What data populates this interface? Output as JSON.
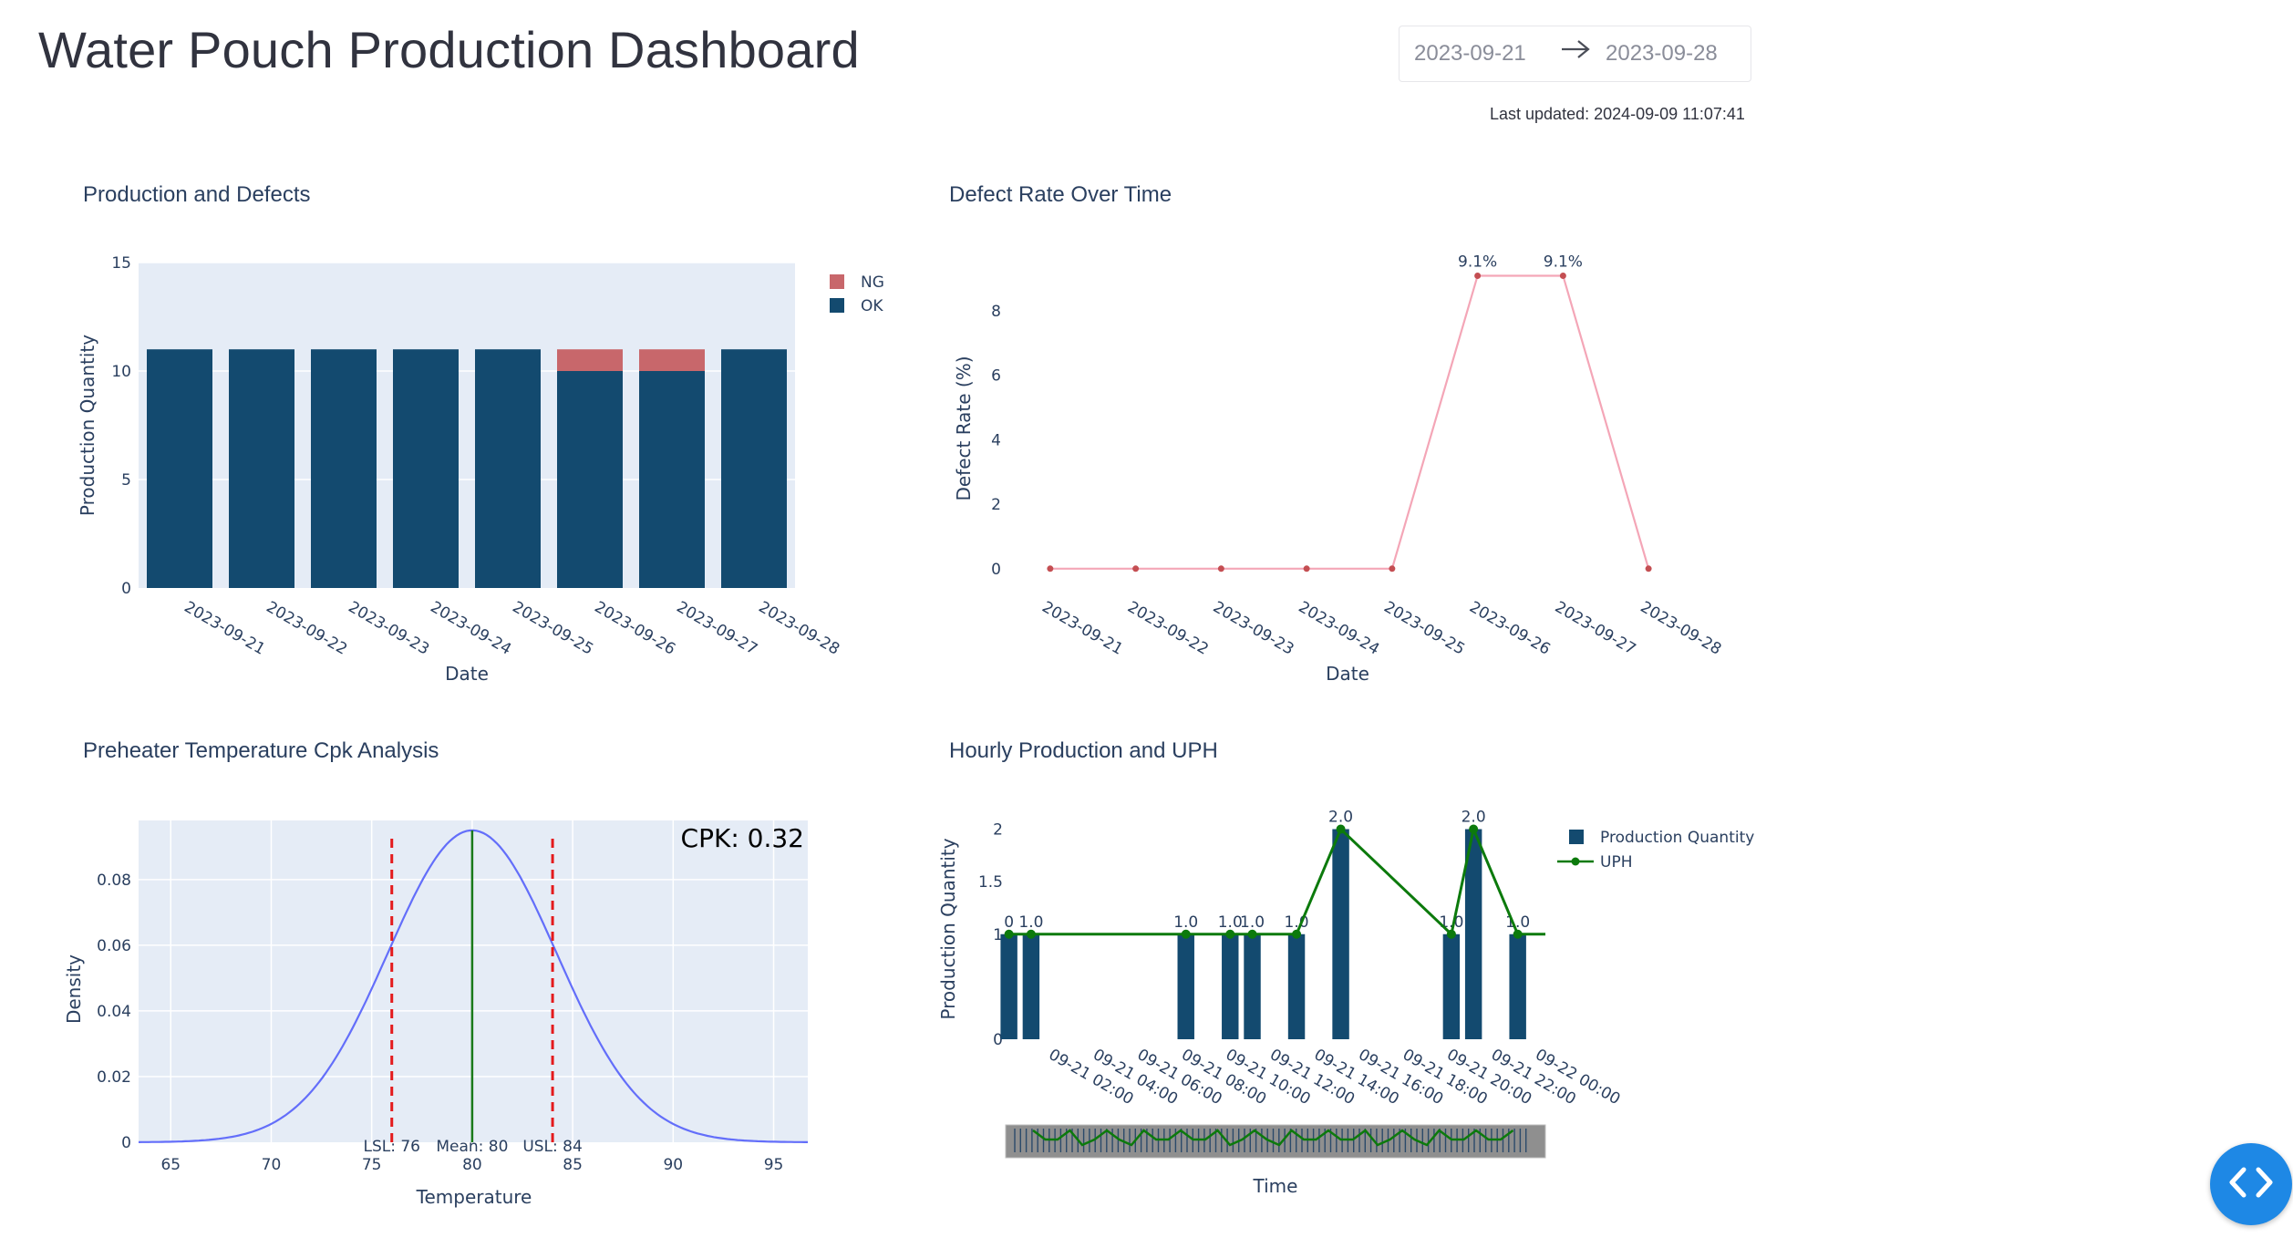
{
  "header": {
    "title": "Water Pouch Production Dashboard",
    "date_start": "2023-09-21",
    "date_end": "2023-09-28",
    "last_updated": "Last updated: 2024-09-09 11:07:41"
  },
  "colors": {
    "ok": "#134a6f",
    "ng": "#c8676b",
    "defect_line": "#f4a6b7",
    "defect_marker": "#c44e52",
    "density_line": "#636efa",
    "spec_limit": "#e41a1c",
    "mean_line": "#1a7a1a",
    "uph_line": "#0c7a0c",
    "plot_bg": "#e5ecf6",
    "accent_button": "#1e88e5"
  },
  "charts": {
    "production": {
      "title": "Production and Defects",
      "xlabel": "Date",
      "ylabel": "Production Quantity",
      "legend": [
        "NG",
        "OK"
      ]
    },
    "defect_rate": {
      "title": "Defect Rate Over Time",
      "xlabel": "Date",
      "ylabel": "Defect Rate (%)"
    },
    "cpk": {
      "title": "Preheater Temperature Cpk Analysis",
      "xlabel": "Temperature",
      "ylabel": "Density",
      "cpk_label": "CPK: 0.32",
      "lsl_label": "LSL: 76",
      "mean_label": "Mean: 80",
      "usl_label": "USL: 84"
    },
    "hourly": {
      "title": "Hourly Production and UPH",
      "xlabel": "Time",
      "ylabel": "Production Quantity",
      "legend": [
        "Production Quantity",
        "UPH"
      ]
    }
  },
  "chart_data": [
    {
      "type": "bar",
      "title": "Production and Defects",
      "xlabel": "Date",
      "ylabel": "Production Quantity",
      "categories": [
        "2023-09-21",
        "2023-09-22",
        "2023-09-23",
        "2023-09-24",
        "2023-09-25",
        "2023-09-26",
        "2023-09-27",
        "2023-09-28"
      ],
      "series": [
        {
          "name": "OK",
          "values": [
            11,
            11,
            11,
            11,
            11,
            10,
            10,
            11
          ]
        },
        {
          "name": "NG",
          "values": [
            0,
            0,
            0,
            0,
            0,
            1,
            1,
            0
          ]
        }
      ],
      "stacked": true,
      "ylim": [
        0,
        15
      ],
      "yticks": [
        0,
        5,
        10,
        15
      ],
      "legend_position": "top-right"
    },
    {
      "type": "line",
      "title": "Defect Rate Over Time",
      "xlabel": "Date",
      "ylabel": "Defect Rate (%)",
      "categories": [
        "2023-09-21",
        "2023-09-22",
        "2023-09-23",
        "2023-09-24",
        "2023-09-25",
        "2023-09-26",
        "2023-09-27",
        "2023-09-28"
      ],
      "values": [
        0,
        0,
        0,
        0,
        0,
        9.09,
        9.09,
        0
      ],
      "data_labels": [
        "",
        "",
        "",
        "",
        "",
        "9.1%",
        "9.1%",
        ""
      ],
      "ylim": [
        -0.6,
        9.5
      ],
      "yticks": [
        0,
        2,
        4,
        6,
        8
      ]
    },
    {
      "type": "line",
      "title": "Preheater Temperature Cpk Analysis",
      "xlabel": "Temperature",
      "ylabel": "Density",
      "distribution": {
        "mean": 80,
        "std": 4.2
      },
      "lsl": 76,
      "usl": 84,
      "cpk": 0.32,
      "xlim": [
        63.4,
        96.7
      ],
      "ylim": [
        0,
        0.098
      ],
      "xticks": [
        65,
        70,
        75,
        80,
        85,
        90,
        95
      ],
      "yticks": [
        0,
        0.02,
        0.04,
        0.06,
        0.08
      ]
    },
    {
      "type": "bar",
      "title": "Hourly Production and UPH",
      "xlabel": "Time",
      "ylabel": "Production Quantity",
      "hours": [
        0,
        1,
        8,
        10,
        11,
        13,
        15,
        20,
        21,
        23
      ],
      "values": [
        1,
        1,
        1,
        1,
        1,
        1,
        2,
        1,
        2,
        1
      ],
      "uph": [
        1,
        1,
        1,
        1,
        1,
        1,
        2,
        1,
        2,
        1
      ],
      "data_labels": [
        "0",
        "1.0",
        "1.0",
        "1.0",
        "1.0",
        "1.0",
        "2.0",
        "1.0",
        "2.0",
        "1.0"
      ],
      "xticks": [
        "09-21 02:00",
        "09-21 04:00",
        "09-21 06:00",
        "09-21 08:00",
        "09-21 10:00",
        "09-21 12:00",
        "09-21 14:00",
        "09-21 16:00",
        "09-21 18:00",
        "09-21 20:00",
        "09-21 22:00",
        "09-22 00:00"
      ],
      "ylim": [
        0,
        2.1
      ],
      "yticks": [
        0,
        0.5,
        1,
        1.5,
        2
      ],
      "ytick_labels": [
        "0",
        "",
        "1",
        "1.5",
        "2"
      ],
      "legend_position": "top-right",
      "range_slider": true
    }
  ]
}
